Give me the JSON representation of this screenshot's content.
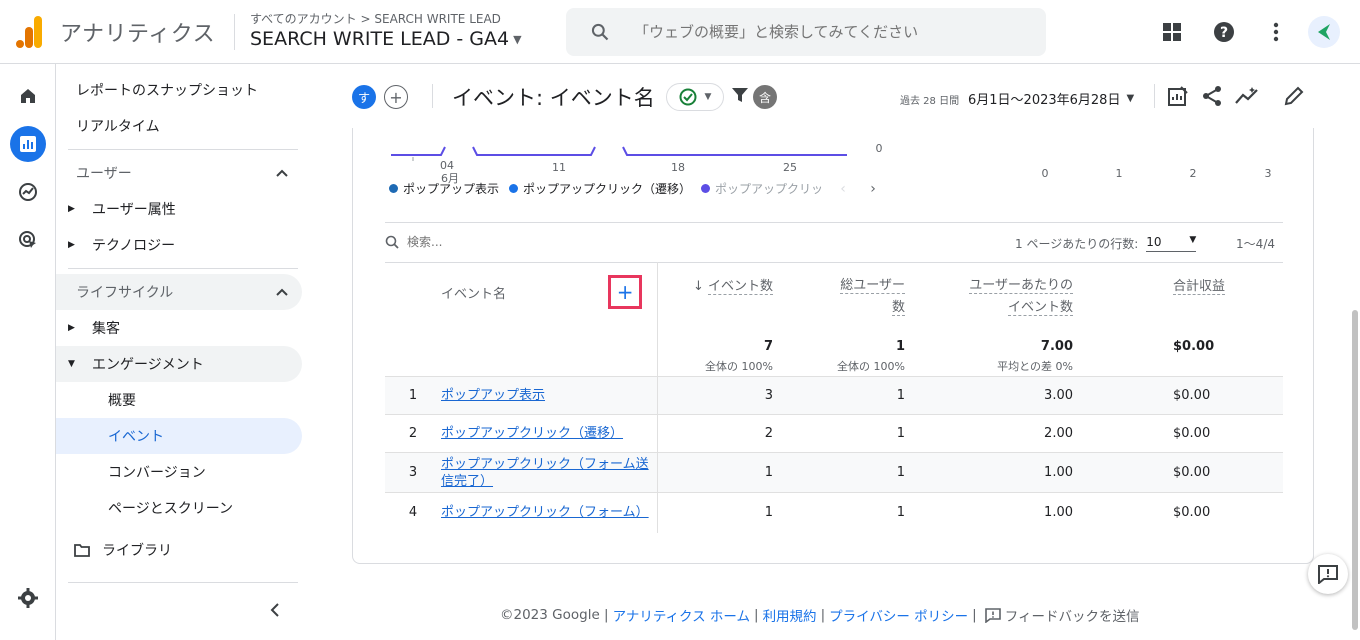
{
  "app": {
    "name": "アナリティクス",
    "account_crumb": "すべてのアカウント > SEARCH WRITE LEAD",
    "property": "SEARCH WRITE LEAD - GA4"
  },
  "search": {
    "placeholder": "「ウェブの概要」と検索してみてください"
  },
  "sidenav": {
    "snapshot": "レポートのスナップショット",
    "realtime": "リアルタイム",
    "user_section": "ユーザー",
    "user_attr": "ユーザー属性",
    "tech": "テクノロジー",
    "lifecycle": "ライフサイクル",
    "acquisition": "集客",
    "engagement": "エンゲージメント",
    "overview": "概要",
    "events": "イベント",
    "conversions": "コンバージョン",
    "pages": "ページとスクリーン",
    "library": "ライブラリ"
  },
  "header": {
    "avatar_letter": "す",
    "title": "イベント: イベント名",
    "compare_letter": "含",
    "date_label": "過去 28 日間",
    "date_range": "6月1日～2023年6月28日"
  },
  "chart": {
    "x_ticks": [
      "04",
      "11",
      "18",
      "25"
    ],
    "x_month": "6月",
    "y_zero": "0",
    "bar_ticks": [
      "0",
      "1",
      "2",
      "3"
    ],
    "legend": [
      {
        "label": "ポップアップ表示",
        "color": "#1e6ab4"
      },
      {
        "label": "ポップアップクリック（遷移）",
        "color": "#1a73e8"
      },
      {
        "label": "ポップアップクリッ",
        "color": "#5c4ee5"
      }
    ]
  },
  "table": {
    "search_placeholder": "検索...",
    "rows_per_page_label": "1 ページあたりの行数:",
    "rows_per_page": "10",
    "page_range": "1～4/4",
    "columns": {
      "name": "イベント名",
      "events": "イベント数",
      "users_1": "総ユーザー",
      "users_2": "数",
      "per_user_1": "ユーザーあたりの",
      "per_user_2": "イベント数",
      "revenue": "合計収益"
    },
    "totals": {
      "events": "7",
      "events_sub": "全体の 100%",
      "users": "1",
      "users_sub": "全体の 100%",
      "per_user": "7.00",
      "per_user_sub": "平均との差 0%",
      "revenue": "$0.00"
    },
    "rows": [
      {
        "idx": "1",
        "name": "ポップアップ表示",
        "events": "3",
        "users": "1",
        "per_user": "3.00",
        "revenue": "$0.00"
      },
      {
        "idx": "2",
        "name": "ポップアップクリック（遷移）",
        "events": "2",
        "users": "1",
        "per_user": "2.00",
        "revenue": "$0.00"
      },
      {
        "idx": "3",
        "name": "ポップアップクリック（フォーム送信完了）",
        "events": "1",
        "users": "1",
        "per_user": "1.00",
        "revenue": "$0.00"
      },
      {
        "idx": "4",
        "name": "ポップアップクリック（フォーム）",
        "events": "1",
        "users": "1",
        "per_user": "1.00",
        "revenue": "$0.00"
      }
    ]
  },
  "footer": {
    "copyright": "©2023 Google |",
    "home": "アナリティクス ホーム",
    "terms": "利用規約",
    "privacy": "プライバシー ポリシー",
    "feedback": "フィードバックを送信"
  },
  "colors": {
    "accent": "#1a73e8",
    "highlight_box": "#e8365d"
  }
}
